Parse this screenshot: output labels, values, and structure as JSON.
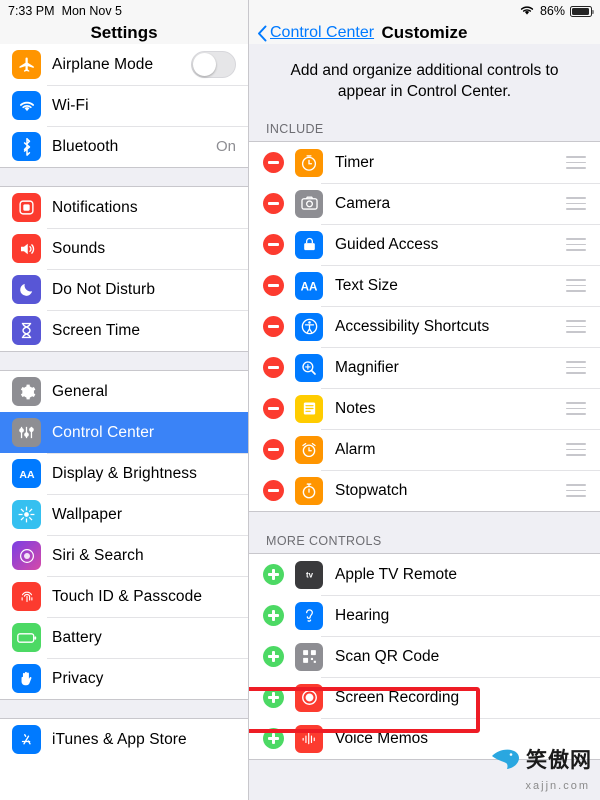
{
  "statusbar": {
    "time": "7:33 PM",
    "date": "Mon Nov 5",
    "battery_percent": "86%",
    "wifi_icon": "wifi-icon",
    "battery_icon": "battery-icon"
  },
  "settings_pane": {
    "title": "Settings",
    "groups": [
      {
        "items": [
          {
            "label": "Airplane Mode",
            "icon": "airplane-icon",
            "color": "#ff9500",
            "accessory": "toggle",
            "toggle_on": false
          },
          {
            "label": "Wi-Fi",
            "icon": "wifi-icon",
            "color": "#007aff",
            "accessory": "none",
            "value": ""
          },
          {
            "label": "Bluetooth",
            "icon": "bluetooth-icon",
            "color": "#007aff",
            "accessory": "value",
            "value": "On"
          }
        ]
      },
      {
        "items": [
          {
            "label": "Notifications",
            "icon": "notifications-icon",
            "color": "#fc3b2f",
            "accessory": "none",
            "value": ""
          },
          {
            "label": "Sounds",
            "icon": "sounds-icon",
            "color": "#fc3b2f",
            "accessory": "none",
            "value": ""
          },
          {
            "label": "Do Not Disturb",
            "icon": "moon-icon",
            "color": "#5856d6",
            "accessory": "none",
            "value": ""
          },
          {
            "label": "Screen Time",
            "icon": "hourglass-icon",
            "color": "#5856d6",
            "accessory": "none",
            "value": ""
          }
        ]
      },
      {
        "items": [
          {
            "label": "General",
            "icon": "gear-icon",
            "color": "#8e8e93",
            "accessory": "none",
            "value": ""
          },
          {
            "label": "Control Center",
            "icon": "control-center-icon",
            "color": "#8e8e93",
            "accessory": "none",
            "selected": true,
            "value": ""
          },
          {
            "label": "Display & Brightness",
            "icon": "display-brightness-icon",
            "color": "#007aff",
            "accessory": "none",
            "value": ""
          },
          {
            "label": "Wallpaper",
            "icon": "wallpaper-icon",
            "color": "#35c0f0",
            "accessory": "none",
            "value": ""
          },
          {
            "label": "Siri & Search",
            "icon": "siri-icon",
            "color": "#6e3ad6",
            "accessory": "none",
            "value": ""
          },
          {
            "label": "Touch ID & Passcode",
            "icon": "touch-id-icon",
            "color": "#fc3b2f",
            "accessory": "none",
            "value": ""
          },
          {
            "label": "Battery",
            "icon": "battery-icon",
            "color": "#4cd964",
            "accessory": "none",
            "value": ""
          },
          {
            "label": "Privacy",
            "icon": "privacy-hand-icon",
            "color": "#007aff",
            "accessory": "none",
            "value": ""
          }
        ]
      },
      {
        "items": [
          {
            "label": "iTunes & App Store",
            "icon": "app-store-icon",
            "color": "#007aff",
            "accessory": "none",
            "value": ""
          }
        ]
      }
    ]
  },
  "detail_pane": {
    "back_label": "Control Center",
    "title": "Customize",
    "intro": "Add and organize additional controls to appear in Control Center.",
    "include_header": "INCLUDE",
    "more_header": "MORE CONTROLS",
    "include_items": [
      {
        "label": "Timer",
        "icon": "timer-icon",
        "color": "#ff9500"
      },
      {
        "label": "Camera",
        "icon": "camera-icon",
        "color": "#8e8e93"
      },
      {
        "label": "Guided Access",
        "icon": "guided-access-icon",
        "color": "#007aff"
      },
      {
        "label": "Text Size",
        "icon": "text-size-icon",
        "color": "#007aff"
      },
      {
        "label": "Accessibility Shortcuts",
        "icon": "accessibility-icon",
        "color": "#007aff"
      },
      {
        "label": "Magnifier",
        "icon": "magnifier-icon",
        "color": "#007aff"
      },
      {
        "label": "Notes",
        "icon": "notes-icon",
        "color": "#ffcc00"
      },
      {
        "label": "Alarm",
        "icon": "alarm-icon",
        "color": "#ff9500"
      },
      {
        "label": "Stopwatch",
        "icon": "stopwatch-icon",
        "color": "#ff9500"
      }
    ],
    "more_items": [
      {
        "label": "Apple TV Remote",
        "icon": "apple-tv-remote-icon",
        "color": "#3a3a3c"
      },
      {
        "label": "Hearing",
        "icon": "hearing-icon",
        "color": "#007aff"
      },
      {
        "label": "Scan QR Code",
        "icon": "qr-code-icon",
        "color": "#8e8e93"
      },
      {
        "label": "Screen Recording",
        "icon": "screen-recording-icon",
        "color": "#fc3b2f",
        "highlighted": true
      },
      {
        "label": "Voice Memos",
        "icon": "voice-memos-icon",
        "color": "#fc3b2f"
      }
    ]
  },
  "annotation": {
    "highlight_color": "#ee1c25",
    "highlight_target": "Screen Recording"
  },
  "watermark": {
    "text": "笑傲网",
    "sub": "xajjn.com"
  }
}
